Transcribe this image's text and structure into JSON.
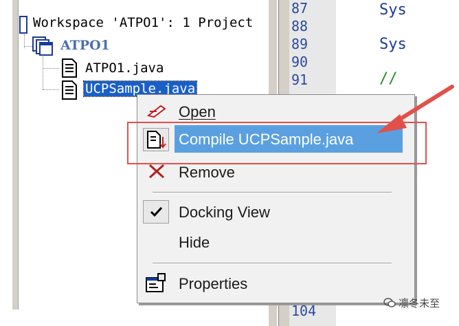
{
  "workspace": {
    "title": "Workspace 'ATPO1': 1 Project",
    "project": "ATPO1",
    "files": [
      "ATPO1.java",
      "UCPSample.java"
    ]
  },
  "editor": {
    "line_numbers": [
      "87",
      "88",
      "89",
      "90",
      "91"
    ],
    "code_lines": [
      "Sys",
      "Sys",
      "//"
    ],
    "bottom_line_number": "104"
  },
  "context_menu": {
    "items": [
      {
        "label": "Open"
      },
      {
        "label": "Compile UCPSample.java"
      },
      {
        "label": "Remove"
      },
      {
        "label": "Docking View"
      },
      {
        "label": "Hide"
      },
      {
        "label": "Properties"
      }
    ]
  },
  "watermark": "凛冬未至",
  "colors": {
    "highlight": "#5aa0e0",
    "annotation": "#e2504a"
  }
}
